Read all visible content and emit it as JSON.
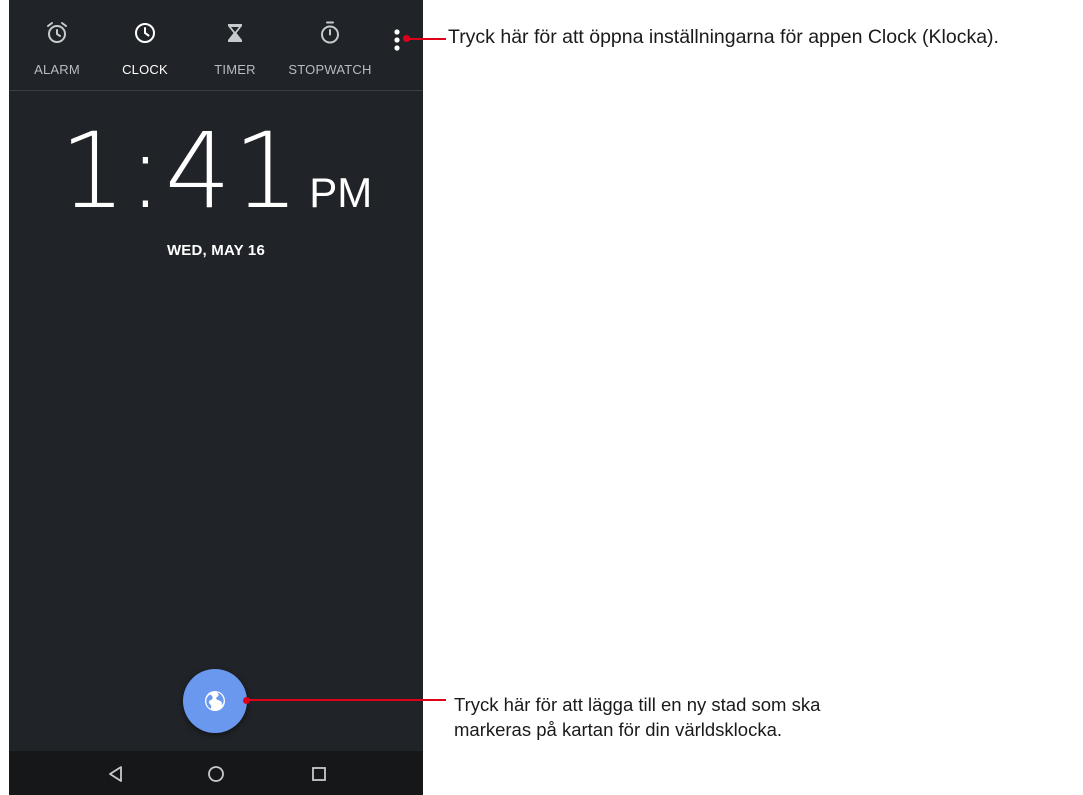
{
  "tabs": [
    {
      "label": "ALARM",
      "icon": "alarm-clock-icon"
    },
    {
      "label": "CLOCK",
      "icon": "clock-icon",
      "active": true
    },
    {
      "label": "TIMER",
      "icon": "hourglass-icon"
    },
    {
      "label": "STOPWATCH",
      "icon": "stopwatch-icon"
    }
  ],
  "menu": {
    "icon": "more-vertical-icon"
  },
  "clock": {
    "time": "1:41",
    "ampm": "PM",
    "date": "WED, MAY 16"
  },
  "fab": {
    "icon": "globe-icon"
  },
  "navbar": {
    "back_icon": "back-triangle-icon",
    "home_icon": "home-circle-icon",
    "recents_icon": "recents-square-icon"
  },
  "callouts": {
    "settings": "Tryck här för att öppna inställningarna för appen Clock (Klocka).",
    "add_city_line1": "Tryck här för att lägga till en ny stad som ska",
    "add_city_line2": "markeras på kartan för din världsklocka."
  },
  "colors": {
    "background": "#202327",
    "fab": "#6a98ef",
    "callout_line": "#e0001a"
  }
}
